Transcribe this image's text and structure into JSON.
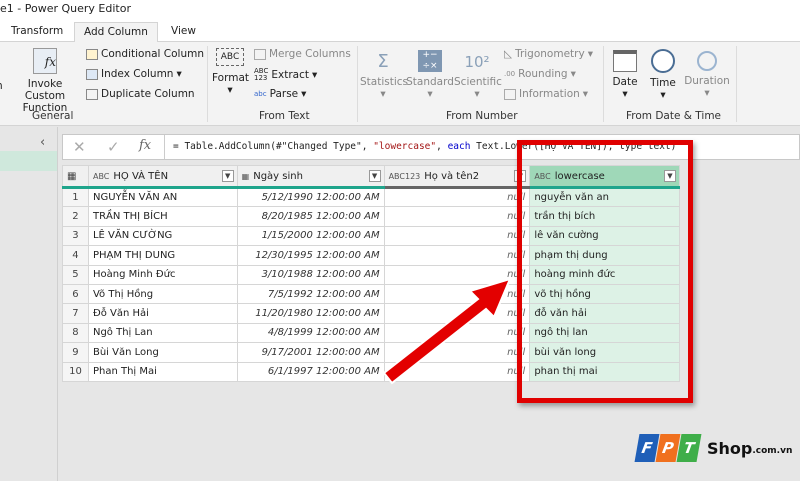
{
  "window": {
    "title": "e1 - Power Query Editor"
  },
  "tabs": [
    {
      "label": "Transform"
    },
    {
      "label": "Add Column",
      "active": true
    },
    {
      "label": "View"
    }
  ],
  "ribbon": {
    "general": {
      "label": "General",
      "items": [
        "n",
        "Invoke Custom",
        "Function",
        "Conditional Column",
        "Index Column",
        "Duplicate Column"
      ]
    },
    "from_text": {
      "label": "From Text",
      "format": "Format",
      "merge": "Merge Columns",
      "extract": "Extract",
      "parse": "Parse"
    },
    "from_number": {
      "label": "From Number",
      "statistics": "Statistics",
      "standard": "Standard",
      "scientific": "Scientific",
      "trig": "Trigonometry",
      "rounding": "Rounding",
      "information": "Information"
    },
    "from_datetime": {
      "label": "From Date & Time",
      "date": "Date",
      "time": "Time",
      "duration": "Duration"
    }
  },
  "formula": {
    "fx": "fx",
    "text_pre": "= Table.AddColumn(#\"Changed Type\", ",
    "text_str": "\"lowercase\"",
    "text_mid": ", ",
    "text_kw": "each",
    "text_post": " Text.Lower([HỌ VÀ TÊN]), type text)"
  },
  "table": {
    "columns": [
      {
        "name": "HỌ VÀ TÊN",
        "type": "ABC"
      },
      {
        "name": "Ngày sinh",
        "type": "date"
      },
      {
        "name": "Họ và tên2",
        "type": "ABC123"
      },
      {
        "name": "lowercase",
        "type": "ABC"
      }
    ],
    "rows": [
      [
        "1",
        "NGUYỄN VĂN AN",
        "5/12/1990 12:00:00 AM",
        "null",
        "nguyễn văn an"
      ],
      [
        "2",
        "TRẦN THỊ BÍCH",
        "8/20/1985 12:00:00 AM",
        "null",
        "trần thị bích"
      ],
      [
        "3",
        "LÊ VĂN CƯỜNG",
        "1/15/2000 12:00:00 AM",
        "null",
        "lê văn cường"
      ],
      [
        "4",
        "PHẠM THỊ DUNG",
        "12/30/1995 12:00:00 AM",
        "null",
        "phạm thị dung"
      ],
      [
        "5",
        "Hoàng Minh Đức",
        "3/10/1988 12:00:00 AM",
        "null",
        "hoàng minh đức"
      ],
      [
        "6",
        "Võ Thị Hồng",
        "7/5/1992 12:00:00 AM",
        "null",
        "võ thị hồng"
      ],
      [
        "7",
        "Đỗ Văn Hải",
        "11/20/1980 12:00:00 AM",
        "null",
        "đỗ văn hải"
      ],
      [
        "8",
        "Ngô Thị Lan",
        "4/8/1999 12:00:00 AM",
        "null",
        "ngô thị lan"
      ],
      [
        "9",
        "Bùi Văn Long",
        "9/17/2001 12:00:00 AM",
        "null",
        "bùi văn long"
      ],
      [
        "10",
        "Phan Thị Mai",
        "6/1/1997 12:00:00 AM",
        "null",
        "phan thị mai"
      ]
    ]
  },
  "watermark": {
    "logo": "FPT",
    "text": "Shop",
    "suffix": ".com.vn"
  },
  "colors": {
    "accent_green": "#1fa58c",
    "highlight": "#e00000",
    "lowercase_bg": "#ddf2e6"
  }
}
